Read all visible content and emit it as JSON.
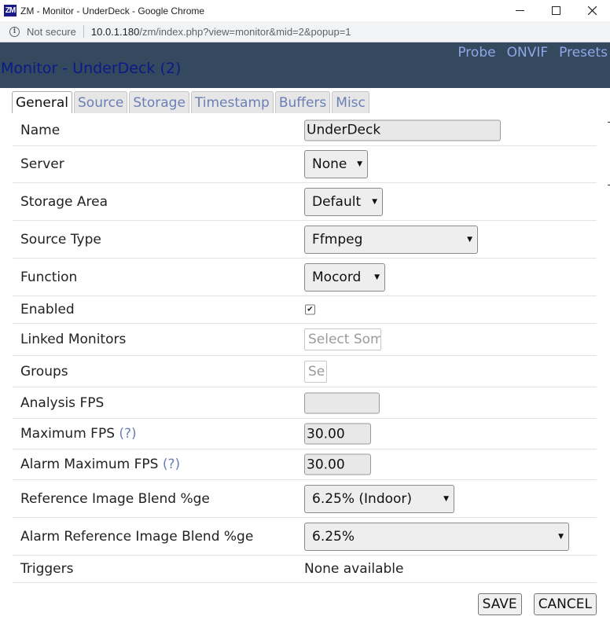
{
  "window": {
    "logo_text": "ZM",
    "title": "ZM - Monitor - UnderDeck - Google Chrome",
    "controls": {
      "minimize": "—",
      "maximize": "☐",
      "close": "✕"
    }
  },
  "urlbar": {
    "security_label": "Not secure",
    "host": "10.0.1.180",
    "path": "/zm/index.php?view=monitor&mid=2&popup=1"
  },
  "header": {
    "title": "Monitor - UnderDeck (2)",
    "links": [
      "Probe",
      "ONVIF",
      "Presets"
    ],
    "background_color": "#34495e"
  },
  "tabs": [
    {
      "label": "General",
      "active": true
    },
    {
      "label": "Source",
      "active": false
    },
    {
      "label": "Storage",
      "active": false
    },
    {
      "label": "Timestamp",
      "active": false
    },
    {
      "label": "Buffers",
      "active": false
    },
    {
      "label": "Misc",
      "active": false
    }
  ],
  "form": {
    "name": {
      "label": "Name",
      "value": "UnderDeck"
    },
    "server": {
      "label": "Server",
      "value": "None"
    },
    "storage_area": {
      "label": "Storage Area",
      "value": "Default"
    },
    "source_type": {
      "label": "Source Type",
      "value": "Ffmpeg"
    },
    "function": {
      "label": "Function",
      "value": "Mocord"
    },
    "enabled": {
      "label": "Enabled",
      "checked": true,
      "check_glyph": "✔"
    },
    "linked_monitors": {
      "label": "Linked Monitors",
      "placeholder": "Select Som"
    },
    "groups": {
      "label": "Groups",
      "placeholder": "Se"
    },
    "analysis_fps": {
      "label": "Analysis FPS",
      "value": ""
    },
    "maximum_fps": {
      "label": "Maximum FPS",
      "help": "(?)",
      "value": "30.00"
    },
    "alarm_maximum_fps": {
      "label": "Alarm Maximum FPS",
      "help": "(?)",
      "value": "30.00"
    },
    "ref_blend": {
      "label": "Reference Image Blend %ge",
      "value": "6.25% (Indoor)"
    },
    "alarm_ref_blend": {
      "label": "Alarm Reference Image Blend %ge",
      "value": "6.25%"
    },
    "triggers": {
      "label": "Triggers",
      "value": "None available"
    }
  },
  "buttons": {
    "save": "SAVE",
    "cancel": "CANCEL"
  },
  "icons": {
    "caret": "caret-down-icon",
    "info": "info-icon"
  }
}
